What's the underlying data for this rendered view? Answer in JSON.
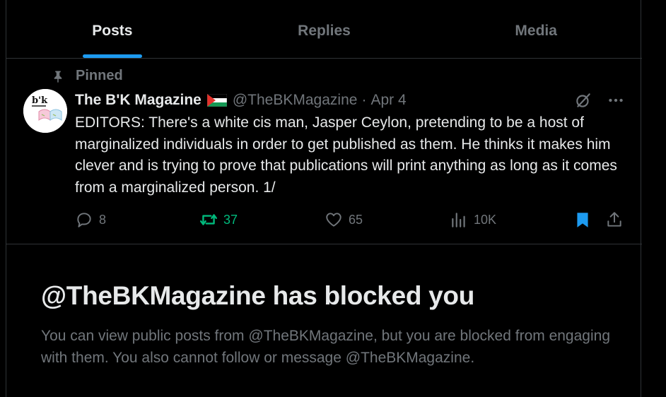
{
  "tabs": [
    {
      "label": "Posts",
      "active": true
    },
    {
      "label": "Replies",
      "active": false
    },
    {
      "label": "Media",
      "active": false
    }
  ],
  "post": {
    "pinned_label": "Pinned",
    "author_name": "The B'K Magazine",
    "handle": "@TheBKMagazine",
    "separator": "·",
    "date": "Apr 4",
    "avatar_text": "b'k",
    "text": "EDITORS: There's a white cis man, Jasper Ceylon, pretending to be a host of marginalized individuals in order to get published as them. He thinks it makes him clever and is trying to prove that publications will print anything as long as it comes from a marginalized person. 1/",
    "stats": {
      "replies": "8",
      "reposts": "37",
      "likes": "65",
      "views": "10K"
    },
    "icons": {
      "flag": "palestine-flag-icon",
      "grok": "grok-icon",
      "more": "more-icon",
      "reply": "reply-icon",
      "repost": "repost-icon",
      "like": "heart-icon",
      "views": "views-icon",
      "bookmark": "bookmark-icon",
      "share": "share-icon"
    }
  },
  "blocked": {
    "title": "@TheBKMagazine has blocked you",
    "body": "You can view public posts from @TheBKMagazine, but you are blocked from engaging with them. You also cannot follow or message @TheBKMagazine."
  },
  "colors": {
    "accent": "#1d9bf0",
    "repost_active": "#00ba7c",
    "muted": "#71767b",
    "text": "#e7e9ea",
    "border": "#2f3336",
    "background": "#000000"
  }
}
